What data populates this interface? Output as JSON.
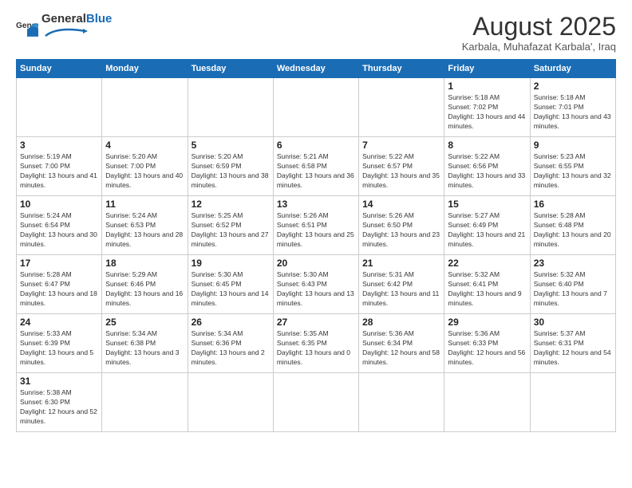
{
  "logo": {
    "text_general": "General",
    "text_blue": "Blue"
  },
  "header": {
    "title": "August 2025",
    "subtitle": "Karbala, Muhafazat Karbala', Iraq"
  },
  "weekdays": [
    "Sunday",
    "Monday",
    "Tuesday",
    "Wednesday",
    "Thursday",
    "Friday",
    "Saturday"
  ],
  "weeks": [
    [
      {
        "day": "",
        "info": ""
      },
      {
        "day": "",
        "info": ""
      },
      {
        "day": "",
        "info": ""
      },
      {
        "day": "",
        "info": ""
      },
      {
        "day": "",
        "info": ""
      },
      {
        "day": "1",
        "info": "Sunrise: 5:18 AM\nSunset: 7:02 PM\nDaylight: 13 hours and 44 minutes."
      },
      {
        "day": "2",
        "info": "Sunrise: 5:18 AM\nSunset: 7:01 PM\nDaylight: 13 hours and 43 minutes."
      }
    ],
    [
      {
        "day": "3",
        "info": "Sunrise: 5:19 AM\nSunset: 7:00 PM\nDaylight: 13 hours and 41 minutes."
      },
      {
        "day": "4",
        "info": "Sunrise: 5:20 AM\nSunset: 7:00 PM\nDaylight: 13 hours and 40 minutes."
      },
      {
        "day": "5",
        "info": "Sunrise: 5:20 AM\nSunset: 6:59 PM\nDaylight: 13 hours and 38 minutes."
      },
      {
        "day": "6",
        "info": "Sunrise: 5:21 AM\nSunset: 6:58 PM\nDaylight: 13 hours and 36 minutes."
      },
      {
        "day": "7",
        "info": "Sunrise: 5:22 AM\nSunset: 6:57 PM\nDaylight: 13 hours and 35 minutes."
      },
      {
        "day": "8",
        "info": "Sunrise: 5:22 AM\nSunset: 6:56 PM\nDaylight: 13 hours and 33 minutes."
      },
      {
        "day": "9",
        "info": "Sunrise: 5:23 AM\nSunset: 6:55 PM\nDaylight: 13 hours and 32 minutes."
      }
    ],
    [
      {
        "day": "10",
        "info": "Sunrise: 5:24 AM\nSunset: 6:54 PM\nDaylight: 13 hours and 30 minutes."
      },
      {
        "day": "11",
        "info": "Sunrise: 5:24 AM\nSunset: 6:53 PM\nDaylight: 13 hours and 28 minutes."
      },
      {
        "day": "12",
        "info": "Sunrise: 5:25 AM\nSunset: 6:52 PM\nDaylight: 13 hours and 27 minutes."
      },
      {
        "day": "13",
        "info": "Sunrise: 5:26 AM\nSunset: 6:51 PM\nDaylight: 13 hours and 25 minutes."
      },
      {
        "day": "14",
        "info": "Sunrise: 5:26 AM\nSunset: 6:50 PM\nDaylight: 13 hours and 23 minutes."
      },
      {
        "day": "15",
        "info": "Sunrise: 5:27 AM\nSunset: 6:49 PM\nDaylight: 13 hours and 21 minutes."
      },
      {
        "day": "16",
        "info": "Sunrise: 5:28 AM\nSunset: 6:48 PM\nDaylight: 13 hours and 20 minutes."
      }
    ],
    [
      {
        "day": "17",
        "info": "Sunrise: 5:28 AM\nSunset: 6:47 PM\nDaylight: 13 hours and 18 minutes."
      },
      {
        "day": "18",
        "info": "Sunrise: 5:29 AM\nSunset: 6:46 PM\nDaylight: 13 hours and 16 minutes."
      },
      {
        "day": "19",
        "info": "Sunrise: 5:30 AM\nSunset: 6:45 PM\nDaylight: 13 hours and 14 minutes."
      },
      {
        "day": "20",
        "info": "Sunrise: 5:30 AM\nSunset: 6:43 PM\nDaylight: 13 hours and 13 minutes."
      },
      {
        "day": "21",
        "info": "Sunrise: 5:31 AM\nSunset: 6:42 PM\nDaylight: 13 hours and 11 minutes."
      },
      {
        "day": "22",
        "info": "Sunrise: 5:32 AM\nSunset: 6:41 PM\nDaylight: 13 hours and 9 minutes."
      },
      {
        "day": "23",
        "info": "Sunrise: 5:32 AM\nSunset: 6:40 PM\nDaylight: 13 hours and 7 minutes."
      }
    ],
    [
      {
        "day": "24",
        "info": "Sunrise: 5:33 AM\nSunset: 6:39 PM\nDaylight: 13 hours and 5 minutes."
      },
      {
        "day": "25",
        "info": "Sunrise: 5:34 AM\nSunset: 6:38 PM\nDaylight: 13 hours and 3 minutes."
      },
      {
        "day": "26",
        "info": "Sunrise: 5:34 AM\nSunset: 6:36 PM\nDaylight: 13 hours and 2 minutes."
      },
      {
        "day": "27",
        "info": "Sunrise: 5:35 AM\nSunset: 6:35 PM\nDaylight: 13 hours and 0 minutes."
      },
      {
        "day": "28",
        "info": "Sunrise: 5:36 AM\nSunset: 6:34 PM\nDaylight: 12 hours and 58 minutes."
      },
      {
        "day": "29",
        "info": "Sunrise: 5:36 AM\nSunset: 6:33 PM\nDaylight: 12 hours and 56 minutes."
      },
      {
        "day": "30",
        "info": "Sunrise: 5:37 AM\nSunset: 6:31 PM\nDaylight: 12 hours and 54 minutes."
      }
    ],
    [
      {
        "day": "31",
        "info": "Sunrise: 5:38 AM\nSunset: 6:30 PM\nDaylight: 12 hours and 52 minutes."
      },
      {
        "day": "",
        "info": ""
      },
      {
        "day": "",
        "info": ""
      },
      {
        "day": "",
        "info": ""
      },
      {
        "day": "",
        "info": ""
      },
      {
        "day": "",
        "info": ""
      },
      {
        "day": "",
        "info": ""
      }
    ]
  ]
}
